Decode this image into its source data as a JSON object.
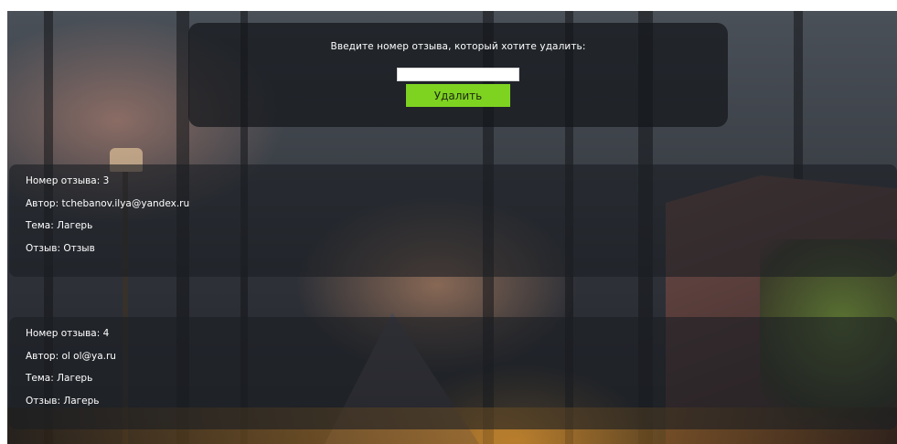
{
  "delete_form": {
    "prompt": "Введите номер отзыва, который хотите удалить:",
    "input_value": "",
    "input_placeholder": "",
    "button_label": "Удалить",
    "button_color": "#7ed321"
  },
  "reviews": [
    {
      "number_label": "Номер отзыва:",
      "number": "3",
      "author_label": "Автор:",
      "author": "tchebanov.ilya@yandex.ru",
      "topic_label": "Тема:",
      "topic": "Лагерь",
      "text_label": "Отзыв:",
      "text": "Отзыв"
    },
    {
      "number_label": "Номер отзыва:",
      "number": "4",
      "author_label": "Автор:",
      "author": "ol ol@ya.ru",
      "topic_label": "Тема:",
      "topic": "Лагерь",
      "text_label": "Отзыв:",
      "text": "Лагерь"
    }
  ]
}
